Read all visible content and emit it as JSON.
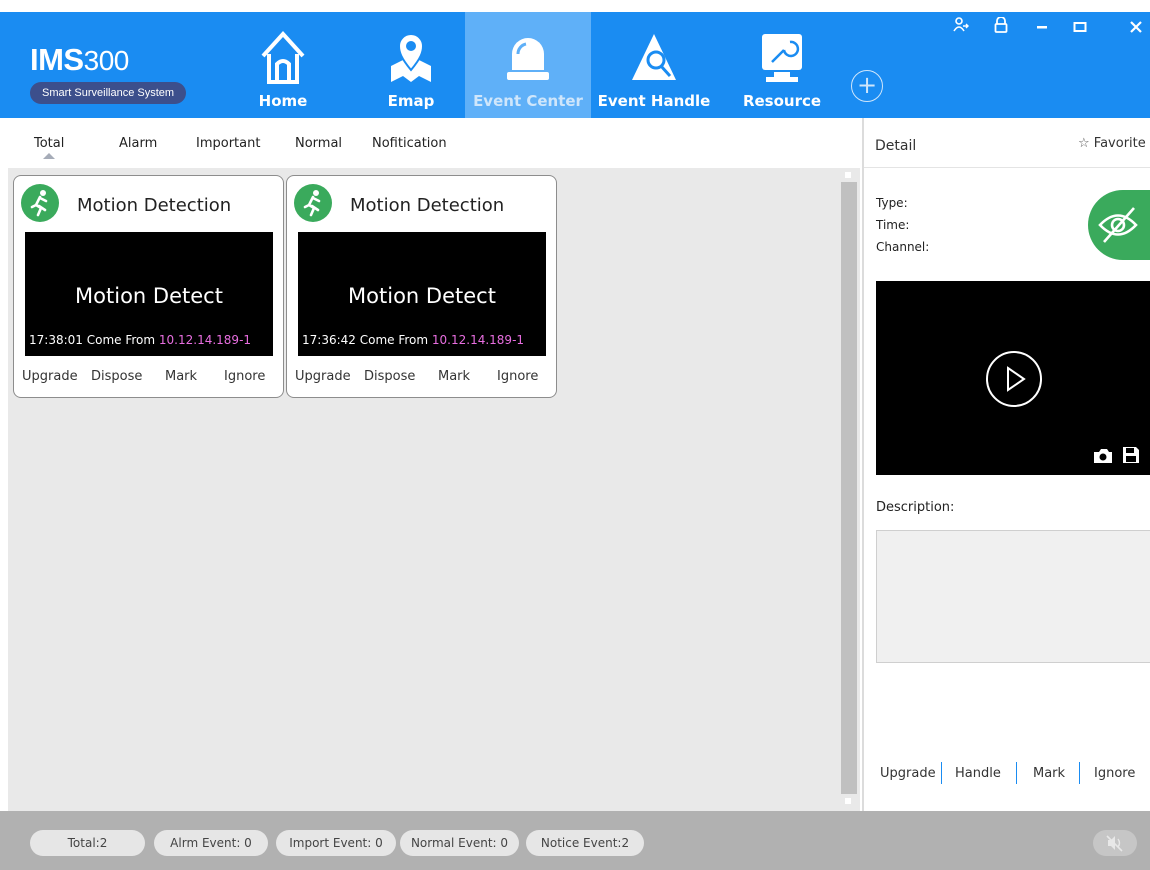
{
  "header": {
    "logo_title": "IMS",
    "logo_num": "300",
    "logo_subtitle": "Smart Surveillance System",
    "nav": [
      {
        "label": "Home",
        "icon": "home-icon"
      },
      {
        "label": "Emap",
        "icon": "map-icon"
      },
      {
        "label": "Event Center",
        "icon": "alarm-bell-icon",
        "active": true
      },
      {
        "label": "Event Handle",
        "icon": "warning-search-icon"
      },
      {
        "label": "Resource",
        "icon": "wrench-monitor-icon"
      }
    ],
    "add_icon": "plus-circle-icon",
    "window_controls": [
      "user-switch-icon",
      "lock-icon",
      "minimize-icon",
      "maximize-icon",
      "close-icon"
    ]
  },
  "filter_tabs": [
    "Total",
    "Alarm",
    "Important",
    "Normal",
    "Nofitication"
  ],
  "events": [
    {
      "title": "Motion Detection",
      "video_text": "Motion Detect",
      "time": "17:38:01",
      "come_from": "Come From",
      "source": "10.12.14.189-1",
      "actions": [
        "Upgrade",
        "Dispose",
        "Mark",
        "Ignore"
      ]
    },
    {
      "title": "Motion Detection",
      "video_text": "Motion Detect",
      "time": "17:36:42",
      "come_from": "Come From",
      "source": "10.12.14.189-1",
      "actions": [
        "Upgrade",
        "Dispose",
        "Mark",
        "Ignore"
      ]
    }
  ],
  "detail": {
    "title": "Detail",
    "favorite": "Favorite",
    "type_label": "Type:",
    "time_label": "Time:",
    "channel_label": "Channel:",
    "description_label": "Description:",
    "actions": [
      "Upgrade",
      "Handle",
      "Mark",
      "Ignore"
    ]
  },
  "status": {
    "total": "Total:2",
    "alarm": "Alrm Event: 0",
    "important": "Import Event: 0",
    "normal": "Normal Event: 0",
    "notice": "Notice Event:2"
  },
  "colors": {
    "header_blue": "#1a8cf2",
    "active_tab": "#5fb0f8",
    "event_green": "#3aaa5c",
    "ip_pink": "#e86ee0",
    "separator_blue": "#1a8cf2"
  }
}
